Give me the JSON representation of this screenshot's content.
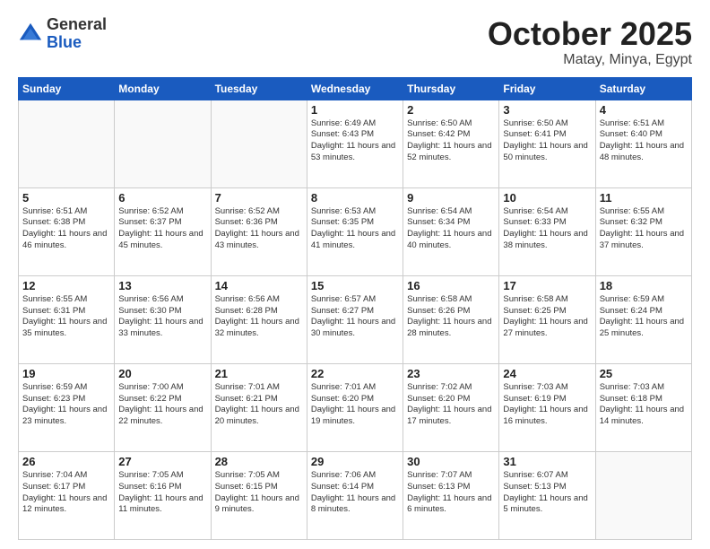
{
  "header": {
    "logo_general": "General",
    "logo_blue": "Blue",
    "month": "October 2025",
    "location": "Matay, Minya, Egypt"
  },
  "calendar": {
    "days_of_week": [
      "Sunday",
      "Monday",
      "Tuesday",
      "Wednesday",
      "Thursday",
      "Friday",
      "Saturday"
    ],
    "weeks": [
      [
        {
          "day": "",
          "info": ""
        },
        {
          "day": "",
          "info": ""
        },
        {
          "day": "",
          "info": ""
        },
        {
          "day": "1",
          "info": "Sunrise: 6:49 AM\nSunset: 6:43 PM\nDaylight: 11 hours\nand 53 minutes."
        },
        {
          "day": "2",
          "info": "Sunrise: 6:50 AM\nSunset: 6:42 PM\nDaylight: 11 hours\nand 52 minutes."
        },
        {
          "day": "3",
          "info": "Sunrise: 6:50 AM\nSunset: 6:41 PM\nDaylight: 11 hours\nand 50 minutes."
        },
        {
          "day": "4",
          "info": "Sunrise: 6:51 AM\nSunset: 6:40 PM\nDaylight: 11 hours\nand 48 minutes."
        }
      ],
      [
        {
          "day": "5",
          "info": "Sunrise: 6:51 AM\nSunset: 6:38 PM\nDaylight: 11 hours\nand 46 minutes."
        },
        {
          "day": "6",
          "info": "Sunrise: 6:52 AM\nSunset: 6:37 PM\nDaylight: 11 hours\nand 45 minutes."
        },
        {
          "day": "7",
          "info": "Sunrise: 6:52 AM\nSunset: 6:36 PM\nDaylight: 11 hours\nand 43 minutes."
        },
        {
          "day": "8",
          "info": "Sunrise: 6:53 AM\nSunset: 6:35 PM\nDaylight: 11 hours\nand 41 minutes."
        },
        {
          "day": "9",
          "info": "Sunrise: 6:54 AM\nSunset: 6:34 PM\nDaylight: 11 hours\nand 40 minutes."
        },
        {
          "day": "10",
          "info": "Sunrise: 6:54 AM\nSunset: 6:33 PM\nDaylight: 11 hours\nand 38 minutes."
        },
        {
          "day": "11",
          "info": "Sunrise: 6:55 AM\nSunset: 6:32 PM\nDaylight: 11 hours\nand 37 minutes."
        }
      ],
      [
        {
          "day": "12",
          "info": "Sunrise: 6:55 AM\nSunset: 6:31 PM\nDaylight: 11 hours\nand 35 minutes."
        },
        {
          "day": "13",
          "info": "Sunrise: 6:56 AM\nSunset: 6:30 PM\nDaylight: 11 hours\nand 33 minutes."
        },
        {
          "day": "14",
          "info": "Sunrise: 6:56 AM\nSunset: 6:28 PM\nDaylight: 11 hours\nand 32 minutes."
        },
        {
          "day": "15",
          "info": "Sunrise: 6:57 AM\nSunset: 6:27 PM\nDaylight: 11 hours\nand 30 minutes."
        },
        {
          "day": "16",
          "info": "Sunrise: 6:58 AM\nSunset: 6:26 PM\nDaylight: 11 hours\nand 28 minutes."
        },
        {
          "day": "17",
          "info": "Sunrise: 6:58 AM\nSunset: 6:25 PM\nDaylight: 11 hours\nand 27 minutes."
        },
        {
          "day": "18",
          "info": "Sunrise: 6:59 AM\nSunset: 6:24 PM\nDaylight: 11 hours\nand 25 minutes."
        }
      ],
      [
        {
          "day": "19",
          "info": "Sunrise: 6:59 AM\nSunset: 6:23 PM\nDaylight: 11 hours\nand 23 minutes."
        },
        {
          "day": "20",
          "info": "Sunrise: 7:00 AM\nSunset: 6:22 PM\nDaylight: 11 hours\nand 22 minutes."
        },
        {
          "day": "21",
          "info": "Sunrise: 7:01 AM\nSunset: 6:21 PM\nDaylight: 11 hours\nand 20 minutes."
        },
        {
          "day": "22",
          "info": "Sunrise: 7:01 AM\nSunset: 6:20 PM\nDaylight: 11 hours\nand 19 minutes."
        },
        {
          "day": "23",
          "info": "Sunrise: 7:02 AM\nSunset: 6:20 PM\nDaylight: 11 hours\nand 17 minutes."
        },
        {
          "day": "24",
          "info": "Sunrise: 7:03 AM\nSunset: 6:19 PM\nDaylight: 11 hours\nand 16 minutes."
        },
        {
          "day": "25",
          "info": "Sunrise: 7:03 AM\nSunset: 6:18 PM\nDaylight: 11 hours\nand 14 minutes."
        }
      ],
      [
        {
          "day": "26",
          "info": "Sunrise: 7:04 AM\nSunset: 6:17 PM\nDaylight: 11 hours\nand 12 minutes."
        },
        {
          "day": "27",
          "info": "Sunrise: 7:05 AM\nSunset: 6:16 PM\nDaylight: 11 hours\nand 11 minutes."
        },
        {
          "day": "28",
          "info": "Sunrise: 7:05 AM\nSunset: 6:15 PM\nDaylight: 11 hours\nand 9 minutes."
        },
        {
          "day": "29",
          "info": "Sunrise: 7:06 AM\nSunset: 6:14 PM\nDaylight: 11 hours\nand 8 minutes."
        },
        {
          "day": "30",
          "info": "Sunrise: 7:07 AM\nSunset: 6:13 PM\nDaylight: 11 hours\nand 6 minutes."
        },
        {
          "day": "31",
          "info": "Sunrise: 6:07 AM\nSunset: 5:13 PM\nDaylight: 11 hours\nand 5 minutes."
        },
        {
          "day": "",
          "info": ""
        }
      ]
    ]
  }
}
